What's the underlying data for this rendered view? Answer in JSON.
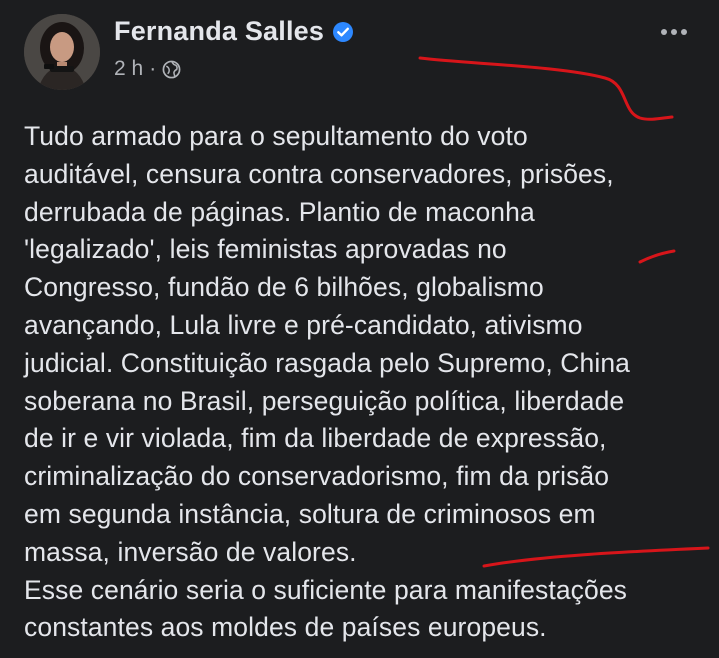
{
  "post": {
    "author": "Fernanda Salles",
    "verified": true,
    "timestamp": "2 h",
    "separator": "·",
    "audience_icon": "globe-icon",
    "more_icon": "more-horizontal-icon",
    "body": "Tudo armado para o sepultamento do voto\nauditável, censura contra conservadores, prisões,\nderrubada de páginas. Plantio de maconha\n'legalizado', leis feministas aprovadas no\nCongresso, fundão de 6 bilhões, globalismo\navançando, Lula livre e pré-candidato, ativismo\njudicial. Constituição rasgada pelo Supremo, China\nsoberana no Brasil, perseguição política, liberdade\nde ir e vir violada, fim da liberdade de expressão,\ncriminalização do conservadorismo, fim da prisão\nem segunda instância, soltura de criminosos em\nmassa, inversão de valores.\nEsse cenário seria o suficiente para manifestações\nconstantes aos moldes de países europeus."
  },
  "colors": {
    "background": "#1c1d1f",
    "text": "#e4e6eb",
    "secondary_text": "#b0b3b8",
    "verified_badge": "#2d88ff",
    "annotation_red": "#d7151a"
  }
}
